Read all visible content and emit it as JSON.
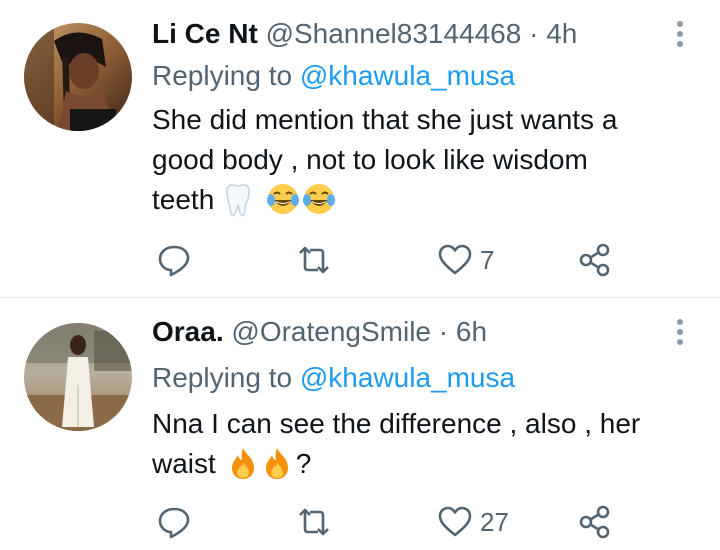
{
  "tweets": [
    {
      "display_name": "Li Ce Nt",
      "handle": "@Shannel83144468",
      "separator": "·",
      "time": "4h",
      "replying_label": "Replying to",
      "replying_to": "@khawula_musa",
      "text_line1": "She did mention that she just wants a",
      "text_line2": "good body , not to look like wisdom",
      "text_line3": "teeth",
      "emoji": [
        "tooth",
        "face-with-tears-of-joy",
        "face-with-tears-of-joy"
      ],
      "likes": "7",
      "retweets": "",
      "replies": ""
    },
    {
      "display_name": "Oraa.",
      "handle": "@OratengSmile",
      "separator": "·",
      "time": "6h",
      "replying_label": "Replying to",
      "replying_to": "@khawula_musa",
      "text_line1": "Nna I can see the difference , also , her",
      "text_line2": "waist",
      "text_tail": "?",
      "emoji": [
        "fire",
        "fire"
      ],
      "likes": "27",
      "retweets": "",
      "replies": ""
    }
  ],
  "colors": {
    "primary_text": "#0f1419",
    "secondary_text": "#536471",
    "link": "#1d9bf0",
    "divider": "#e6ecf0"
  }
}
